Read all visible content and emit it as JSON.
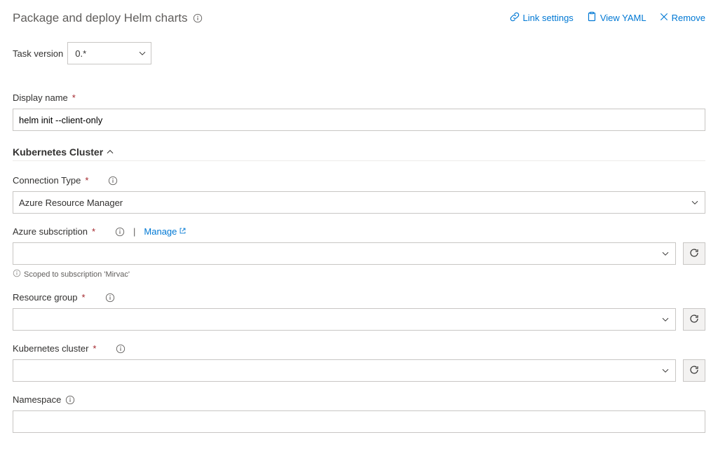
{
  "header": {
    "title": "Package and deploy Helm charts",
    "actions": {
      "linkSettings": "Link settings",
      "viewYaml": "View YAML",
      "remove": "Remove"
    }
  },
  "taskVersion": {
    "label": "Task version",
    "value": "0.*"
  },
  "displayName": {
    "label": "Display name",
    "value": "helm init --client-only"
  },
  "section": {
    "kubernetesCluster": "Kubernetes Cluster"
  },
  "connectionType": {
    "label": "Connection Type",
    "value": "Azure Resource Manager"
  },
  "azureSubscription": {
    "label": "Azure subscription",
    "manage": "Manage",
    "value": "",
    "hint": "Scoped to subscription 'Mirvac'"
  },
  "resourceGroup": {
    "label": "Resource group",
    "value": ""
  },
  "kubernetesClusterField": {
    "label": "Kubernetes cluster",
    "value": ""
  },
  "namespace": {
    "label": "Namespace",
    "value": ""
  }
}
